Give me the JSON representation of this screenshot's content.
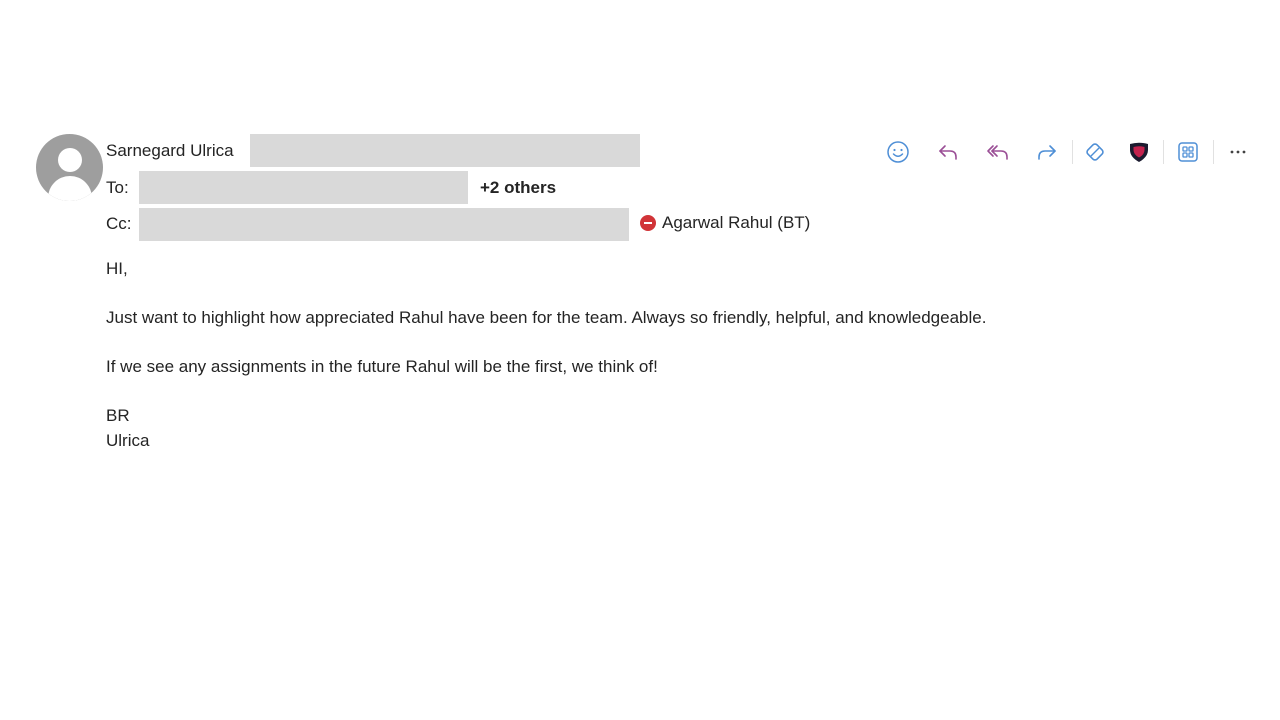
{
  "sender": {
    "name": "Sarnegard Ulrica"
  },
  "recipients": {
    "to_label": "To:",
    "to_more": "+2 others",
    "cc_label": "Cc:",
    "cc_named": "Agarwal Rahul (BT)"
  },
  "toolbar": {
    "icons": [
      "emoji-icon",
      "reply-icon",
      "reply-all-icon",
      "forward-icon",
      "tag-icon",
      "shield-icon",
      "apps-icon",
      "more-icon"
    ],
    "accent_color": "#4f8fd6",
    "reply_color": "#9b4f96"
  },
  "message": {
    "greeting": "HI,",
    "paragraph1": "Just want to highlight how appreciated Rahul have been for the team. Always so friendly, helpful, and knowledgeable.",
    "paragraph2": "If we see any assignments in the future Rahul will be the first, we think of!",
    "signoff": "BR",
    "signature": "Ulrica"
  }
}
